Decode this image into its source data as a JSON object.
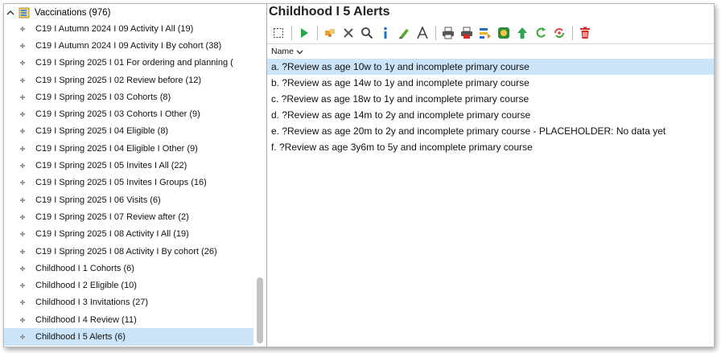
{
  "tree": {
    "root_label": "Vaccinations (976)",
    "items": [
      {
        "label": "C19 I Autumn 2024 I 09 Activity I All (19)"
      },
      {
        "label": "C19 I Autumn 2024 I 09 Activity I By cohort (38)"
      },
      {
        "label": "C19 I Spring 2025 I 01 For ordering and planning ("
      },
      {
        "label": "C19 I Spring 2025 I 02 Review before (12)"
      },
      {
        "label": "C19 I Spring 2025 I 03 Cohorts (8)"
      },
      {
        "label": "C19 I Spring 2025 I 03 Cohorts I Other (9)"
      },
      {
        "label": "C19 I Spring 2025 I 04 Eligible (8)"
      },
      {
        "label": "C19 I Spring 2025 I 04 Eligible I Other (9)"
      },
      {
        "label": "C19 I Spring 2025 I 05 Invites I All (22)"
      },
      {
        "label": "C19 I Spring 2025 I 05 Invites I Groups (16)"
      },
      {
        "label": "C19 I Spring 2025 I 06 Visits (6)"
      },
      {
        "label": "C19 I Spring 2025 I 07 Review after (2)"
      },
      {
        "label": "C19 I Spring 2025 I 08 Activity I All (19)"
      },
      {
        "label": "C19 I Spring 2025 I 08 Activity I By cohort (26)"
      },
      {
        "label": "Childhood I 1 Cohorts (6)"
      },
      {
        "label": "Childhood I 2 Eligible (10)"
      },
      {
        "label": "Childhood I 3 Invitations (27)"
      },
      {
        "label": "Childhood I 4 Review (11)"
      },
      {
        "label": "Childhood I 5 Alerts (6)",
        "selected": true
      }
    ]
  },
  "content": {
    "title": "Childhood I 5 Alerts",
    "column_header": "Name",
    "toolbar_icons": [
      "select-all-icon",
      "run-icon",
      "puzzle-icon",
      "delete-x-icon",
      "search-icon",
      "info-icon",
      "edit-pen-icon",
      "font-icon",
      "print-icon",
      "print-red-icon",
      "export-icon",
      "record-icon",
      "upload-green-icon",
      "refresh-icon",
      "sync-icon",
      "trash-icon"
    ],
    "rows": [
      {
        "label": "a. ?Review as age 10w to 1y and incomplete primary course",
        "selected": true
      },
      {
        "label": "b. ?Review as age 14w to 1y and incomplete primary course"
      },
      {
        "label": "c. ?Review as age 18w to 1y and incomplete primary course"
      },
      {
        "label": "d. ?Review as age 14m to 2y and incomplete primary course"
      },
      {
        "label": "e. ?Review as age 20m to 2y and incomplete primary course - PLACEHOLDER: No data yet"
      },
      {
        "label": "f. ?Review as age 3y6m to 5y and incomplete primary course"
      }
    ]
  },
  "colors": {
    "selection": "#cce4f7",
    "run_green": "#2ea44f",
    "info_blue": "#1a73c8",
    "trash_red": "#d62b2b"
  }
}
